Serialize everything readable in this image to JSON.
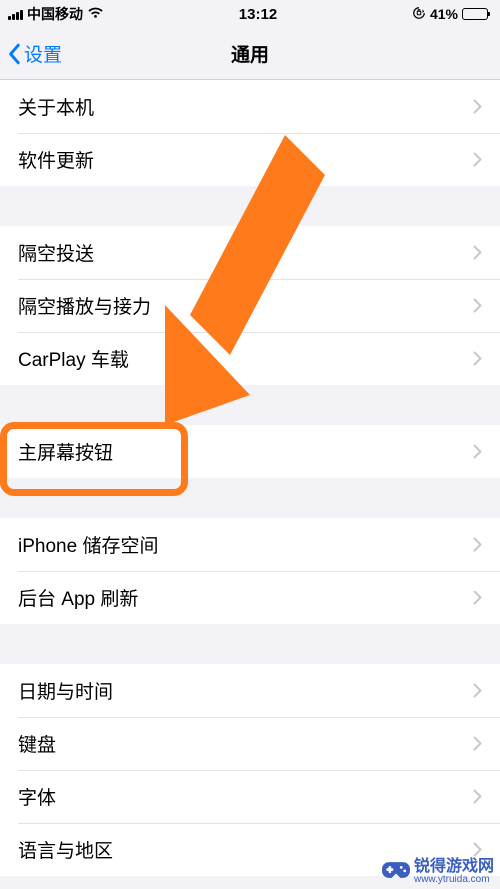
{
  "status": {
    "carrier": "中国移动",
    "time": "13:12",
    "battery_pct": "41%"
  },
  "nav": {
    "back_label": "设置",
    "title": "通用"
  },
  "groups": [
    {
      "rows": [
        {
          "id": "about",
          "label": "关于本机"
        },
        {
          "id": "software-update",
          "label": "软件更新"
        }
      ]
    },
    {
      "rows": [
        {
          "id": "airdrop",
          "label": "隔空投送"
        },
        {
          "id": "airplay-handoff",
          "label": "隔空播放与接力"
        },
        {
          "id": "carplay",
          "label": "CarPlay 车载"
        }
      ]
    },
    {
      "rows": [
        {
          "id": "home-button",
          "label": "主屏幕按钮"
        }
      ]
    },
    {
      "rows": [
        {
          "id": "iphone-storage",
          "label": "iPhone 储存空间"
        },
        {
          "id": "background-app-refresh",
          "label": "后台 App 刷新"
        }
      ]
    },
    {
      "rows": [
        {
          "id": "date-time",
          "label": "日期与时间"
        },
        {
          "id": "keyboard",
          "label": "键盘"
        },
        {
          "id": "fonts",
          "label": "字体"
        },
        {
          "id": "language-region",
          "label": "语言与地区"
        }
      ]
    }
  ],
  "watermark": {
    "text": "锐得游戏网",
    "sub": "www.ytruida.com"
  },
  "highlight_arrow_color": "#ff7a1a"
}
